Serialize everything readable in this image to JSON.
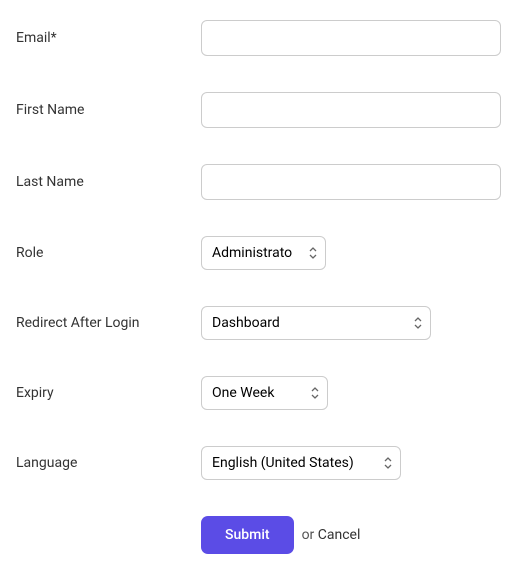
{
  "form": {
    "email": {
      "label": "Email*",
      "value": ""
    },
    "first_name": {
      "label": "First Name",
      "value": ""
    },
    "last_name": {
      "label": "Last Name",
      "value": ""
    },
    "role": {
      "label": "Role",
      "selected": "Administrator"
    },
    "redirect": {
      "label": "Redirect After Login",
      "selected": "Dashboard"
    },
    "expiry": {
      "label": "Expiry",
      "selected": "One Week"
    },
    "language": {
      "label": "Language",
      "selected": "English (United States)"
    }
  },
  "actions": {
    "submit": "Submit",
    "or": "or ",
    "cancel": "Cancel"
  }
}
